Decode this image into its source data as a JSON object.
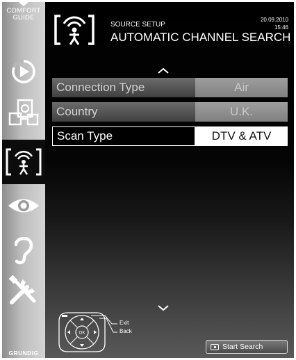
{
  "sidebar": {
    "comfort_line1": "COMFORT",
    "comfort_line2": "GUIDE",
    "brand": "GRUNDIG",
    "items": [
      {
        "icon": "play-icon"
      },
      {
        "icon": "source-icon"
      },
      {
        "icon": "antenna-person-icon",
        "active": true
      },
      {
        "icon": "eye-icon"
      },
      {
        "icon": "ear-icon"
      },
      {
        "icon": "tools-icon"
      }
    ]
  },
  "header": {
    "source": "SOURCE SETUP",
    "title": "AUTOMATIC CHANNEL SEARCH",
    "date": "20.09.2010",
    "time": "15:46"
  },
  "settings": [
    {
      "label": "Connection Type",
      "value": "Air",
      "state": "dim"
    },
    {
      "label": "Country",
      "value": "U.K.",
      "state": "dim"
    },
    {
      "label": "Scan Type",
      "value": "DTV & ATV",
      "state": "selected"
    }
  ],
  "hints": {
    "exit": "Exit",
    "back": "Back",
    "ok": "OK",
    "start_search": "Start Search"
  },
  "colors": {
    "selected_value_bg": "#ffffff",
    "dim_label_bg": "#565656",
    "dim_value_bg": "#8f8f8f"
  }
}
